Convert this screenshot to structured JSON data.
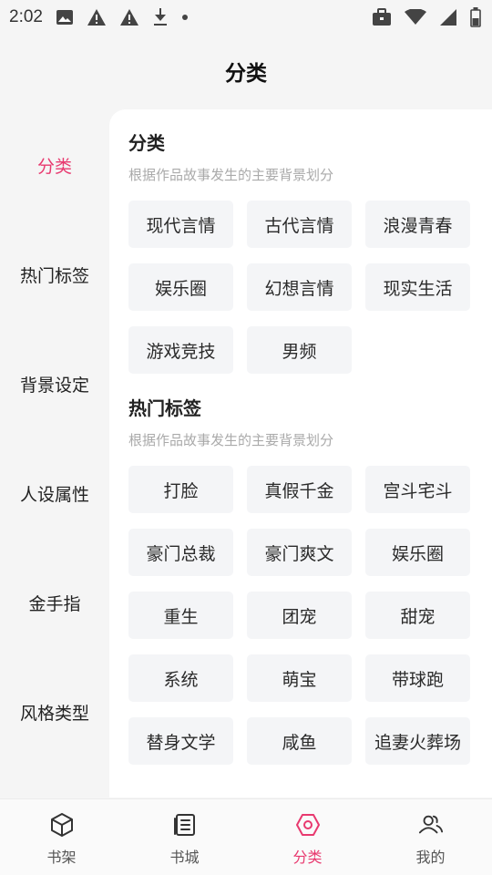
{
  "status_bar": {
    "time": "2:02",
    "left_icons": [
      "image-icon",
      "warning-icon",
      "warning-icon",
      "download-icon",
      "dot-icon"
    ],
    "right_icons": [
      "briefcase-icon",
      "wifi-icon",
      "signal-icon",
      "battery-icon"
    ]
  },
  "header": {
    "title": "分类"
  },
  "colors": {
    "accent": "#e8396f",
    "chip_bg": "#f4f5f7",
    "desc_text": "#aaaaaa"
  },
  "sidebar": {
    "items": [
      {
        "label": "分类",
        "active": true
      },
      {
        "label": "热门标签",
        "active": false
      },
      {
        "label": "背景设定",
        "active": false
      },
      {
        "label": "人设属性",
        "active": false
      },
      {
        "label": "金手指",
        "active": false
      },
      {
        "label": "风格类型",
        "active": false
      }
    ]
  },
  "sections": [
    {
      "title": "分类",
      "desc": "根据作品故事发生的主要背景划分",
      "chips": [
        "现代言情",
        "古代言情",
        "浪漫青春",
        "娱乐圈",
        "幻想言情",
        "现实生活",
        "游戏竞技",
        "男频"
      ]
    },
    {
      "title": "热门标签",
      "desc": "根据作品故事发生的主要背景划分",
      "chips": [
        "打脸",
        "真假千金",
        "宫斗宅斗",
        "豪门总裁",
        "豪门爽文",
        "娱乐圈",
        "重生",
        "团宠",
        "甜宠",
        "系统",
        "萌宝",
        "带球跑",
        "替身文学",
        "咸鱼",
        "追妻火葬场"
      ]
    }
  ],
  "bottom_nav": {
    "items": [
      {
        "label": "书架",
        "icon": "cube-icon",
        "active": false
      },
      {
        "label": "书城",
        "icon": "book-list-icon",
        "active": false
      },
      {
        "label": "分类",
        "icon": "hexagon-icon",
        "active": true
      },
      {
        "label": "我的",
        "icon": "users-icon",
        "active": false
      }
    ]
  }
}
